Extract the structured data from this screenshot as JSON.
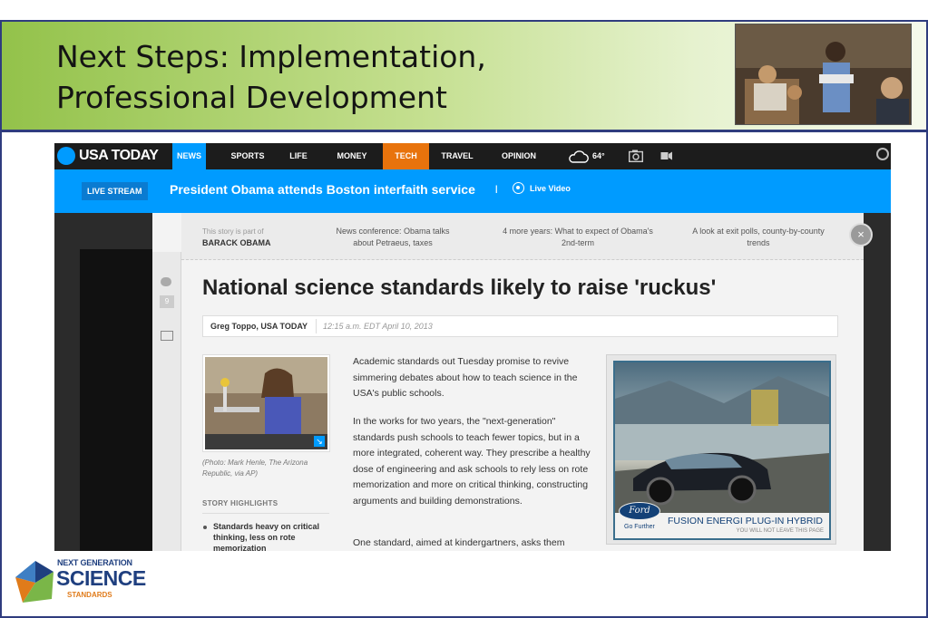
{
  "slide": {
    "title_line1": "Next Steps: Implementation,",
    "title_line2": "Professional Development"
  },
  "usatoday": {
    "logo": "USA TODAY",
    "nav": [
      "NEWS",
      "SPORTS",
      "LIFE",
      "MONEY",
      "TECH",
      "TRAVEL",
      "OPINION"
    ],
    "weather": "64°",
    "breaking": {
      "badge": "LIVE STREAM",
      "text": "President Obama attends Boston interfaith service",
      "separator": "|",
      "live_video": "Live Video"
    },
    "story_bar": {
      "part_of": "This story is part of",
      "topic": "BARACK OBAMA",
      "links": [
        "News conference: Obama talks about Petraeus, taxes",
        "4 more years: What to expect of Obama's 2nd-term",
        "A look at exit polls, county-by-county trends"
      ]
    },
    "comment_count": "9",
    "headline": "National science standards likely to raise 'ruckus'",
    "byline": {
      "author": "Greg Toppo, USA TODAY",
      "date": "12:15 a.m. EDT April 10, 2013"
    },
    "photo_caption": "(Photo: Mark Henle, The Arizona Republic, via AP)",
    "highlights": {
      "title": "STORY HIGHLIGHTS",
      "items": [
        "Standards heavy on critical thinking, less on rote memorization"
      ]
    },
    "paragraphs": [
      "Academic standards out Tuesday promise to revive simmering debates about how to teach science in the USA's public schools.",
      "In the works for two years, the \"next-generation\" standards push schools to teach fewer topics, but in a more integrated, coherent way. They prescribe a healthy dose of engineering and ask schools to rely less on rote memorization and more on critical thinking, constructing arguments and building demonstrations.",
      "One standard, aimed at kindergartners, asks them"
    ],
    "ad": {
      "brand": "Ford",
      "tagline": "Go Further",
      "headline": "FUSION ENERGI PLUG-IN HYBRID",
      "subtext": "YOU WILL NOT LEAVE THIS PAGE"
    }
  },
  "ngss_logo": {
    "top": "NEXT GENERATION",
    "main": "SCIENCE",
    "bottom": "STANDARDS"
  }
}
